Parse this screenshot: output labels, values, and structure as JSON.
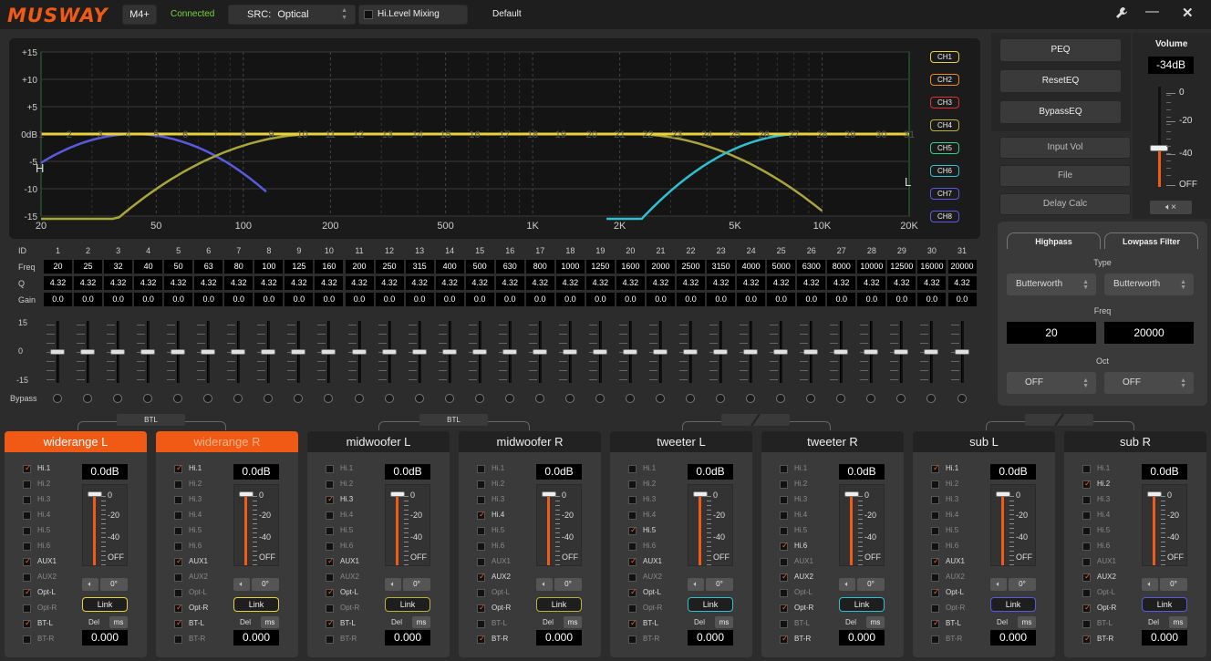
{
  "app": {
    "logo": "MUSWAY",
    "model": "M4+",
    "status": "Connected",
    "src_label": "SRC:",
    "src_value": "Optical",
    "hilevel": "Hi.Level Mixing",
    "preset": "Default",
    "colors": {
      "accent": "#f05a14",
      "connected": "#7ad33b"
    }
  },
  "window": {
    "settings_icon": "wrench-icon",
    "min_icon": "minimize-icon",
    "close_icon": "close-icon"
  },
  "graph": {
    "y_labels": [
      "+15",
      "+10",
      "+5",
      "0dB",
      "-5",
      "-10",
      "-15"
    ],
    "x_labels": [
      "20",
      "50",
      "100",
      "200",
      "500",
      "1K",
      "2K",
      "5K",
      "10K",
      "20K"
    ],
    "band_markers": [
      "1",
      "2",
      "3",
      "4",
      "5",
      "6",
      "7",
      "8",
      "9",
      "10",
      "11",
      "12",
      "13",
      "14",
      "15",
      "16",
      "17",
      "18",
      "19",
      "20",
      "21",
      "22",
      "23",
      "24",
      "25",
      "26",
      "27",
      "28",
      "29",
      "30",
      "31"
    ],
    "left_mark": "H",
    "right_mark": "L"
  },
  "channels_legend": [
    {
      "label": "CH1",
      "color": "#e8d23a"
    },
    {
      "label": "CH2",
      "color": "#f08a1e"
    },
    {
      "label": "CH3",
      "color": "#e03030"
    },
    {
      "label": "CH4",
      "color": "#b7b33a"
    },
    {
      "label": "CH5",
      "color": "#2fd08e"
    },
    {
      "label": "CH6",
      "color": "#2fc0d0"
    },
    {
      "label": "CH7",
      "color": "#5a5ae0"
    },
    {
      "label": "CH8",
      "color": "#5a5ae0"
    }
  ],
  "right_buttons": {
    "peq": "PEQ",
    "reset": "ResetEQ",
    "bypass": "BypassEQ",
    "input_vol": "Input Vol",
    "file": "File",
    "delay": "Delay Calc"
  },
  "volume": {
    "label": "Volume",
    "value": "-34dB",
    "scale": [
      "0",
      "-20",
      "-40",
      "OFF"
    ],
    "level_db": -34,
    "mute_icon": "speaker-mute-icon"
  },
  "crossover": {
    "hp_title": "Highpass",
    "lp_title": "Lowpass Filter",
    "type_label": "Type",
    "hp_type": "Butterworth",
    "lp_type": "Butterworth",
    "freq_label": "Freq",
    "hp_freq": "20",
    "lp_freq": "20000",
    "oct_label": "Oct",
    "hp_oct": "OFF",
    "lp_oct": "OFF"
  },
  "bands": {
    "row_labels": {
      "id": "ID",
      "freq": "Freq",
      "q": "Q",
      "gain": "Gain",
      "bypass": "Bypass"
    },
    "scale": [
      "15",
      "0",
      "-15"
    ],
    "ids": [
      "1",
      "2",
      "3",
      "4",
      "5",
      "6",
      "7",
      "8",
      "9",
      "10",
      "11",
      "12",
      "13",
      "14",
      "15",
      "16",
      "17",
      "18",
      "19",
      "20",
      "21",
      "22",
      "23",
      "24",
      "25",
      "26",
      "27",
      "28",
      "29",
      "30",
      "31"
    ],
    "freqs": [
      "20",
      "25",
      "32",
      "40",
      "50",
      "63",
      "80",
      "100",
      "125",
      "160",
      "200",
      "250",
      "315",
      "400",
      "500",
      "630",
      "800",
      "1000",
      "1250",
      "1600",
      "2000",
      "2500",
      "3150",
      "4000",
      "5000",
      "6300",
      "8000",
      "10000",
      "12500",
      "16000",
      "20000"
    ],
    "q": [
      "4.32",
      "4.32",
      "4.32",
      "4.32",
      "4.32",
      "4.32",
      "4.32",
      "4.32",
      "4.32",
      "4.32",
      "4.32",
      "4.32",
      "4.32",
      "4.32",
      "4.32",
      "4.32",
      "4.32",
      "4.32",
      "4.32",
      "4.32",
      "4.32",
      "4.32",
      "4.32",
      "4.32",
      "4.32",
      "4.32",
      "4.32",
      "4.32",
      "4.32",
      "4.32",
      "4.32"
    ],
    "gain": [
      "0.0",
      "0.0",
      "0.0",
      "0.0",
      "0.0",
      "0.0",
      "0.0",
      "0.0",
      "0.0",
      "0.0",
      "0.0",
      "0.0",
      "0.0",
      "0.0",
      "0.0",
      "0.0",
      "0.0",
      "0.0",
      "0.0",
      "0.0",
      "0.0",
      "0.0",
      "0.0",
      "0.0",
      "0.0",
      "0.0",
      "0.0",
      "0.0",
      "0.0",
      "0.0",
      "0.0"
    ]
  },
  "btl": [
    "BTL",
    "BTL"
  ],
  "input_labels": [
    "Hi.1",
    "Hi.2",
    "Hi.3",
    "Hi.4",
    "Hi.5",
    "Hi.6",
    "AUX1",
    "AUX2",
    "Opt-L",
    "Opt-R",
    "BT-L",
    "BT-R"
  ],
  "out_channels": [
    {
      "name": "widerange L",
      "state": "active",
      "db": "0.0dB",
      "checked": [
        0,
        6,
        8,
        10
      ],
      "link": "Link",
      "link_color": "#e8d23a",
      "phase": "0°",
      "del": "Del",
      "ms": "ms",
      "delay": "0.000"
    },
    {
      "name": "widerange R",
      "state": "active2",
      "db": "0.0dB",
      "checked": [
        0,
        6,
        9,
        10
      ],
      "link": "Link",
      "link_color": "#e8d23a",
      "phase": "0°",
      "del": "Del",
      "ms": "ms",
      "delay": "0.000"
    },
    {
      "name": "midwoofer L",
      "state": "",
      "db": "0.0dB",
      "checked": [
        2,
        6,
        8,
        10
      ],
      "link": "Link",
      "link_color": "#b7b33a",
      "phase": "0°",
      "del": "Del",
      "ms": "ms",
      "delay": "0.000"
    },
    {
      "name": "midwoofer R",
      "state": "",
      "db": "0.0dB",
      "checked": [
        3,
        7,
        9,
        11
      ],
      "link": "Link",
      "link_color": "#b7b33a",
      "phase": "0°",
      "del": "Del",
      "ms": "ms",
      "delay": "0.000"
    },
    {
      "name": "tweeter L",
      "state": "",
      "db": "0.0dB",
      "checked": [
        4,
        6,
        8,
        10
      ],
      "link": "Link",
      "link_color": "#2fc0d0",
      "phase": "0°",
      "del": "Del",
      "ms": "ms",
      "delay": "0.000"
    },
    {
      "name": "tweeter R",
      "state": "",
      "db": "0.0dB",
      "checked": [
        5,
        7,
        9,
        11
      ],
      "link": "Link",
      "link_color": "#2fc0d0",
      "phase": "0°",
      "del": "Del",
      "ms": "ms",
      "delay": "0.000"
    },
    {
      "name": "sub L",
      "state": "",
      "db": "0.0dB",
      "checked": [
        0,
        6,
        8,
        10
      ],
      "link": "Link",
      "link_color": "#5a5ae0",
      "phase": "0°",
      "del": "Del",
      "ms": "ms",
      "delay": "0.000"
    },
    {
      "name": "sub R",
      "state": "",
      "db": "0.0dB",
      "checked": [
        1,
        7,
        9,
        11
      ],
      "link": "Link",
      "link_color": "#5a5ae0",
      "phase": "0°",
      "del": "Del",
      "ms": "ms",
      "delay": "0.000"
    }
  ],
  "out_scale": [
    "0",
    "-20",
    "-40",
    "OFF"
  ]
}
